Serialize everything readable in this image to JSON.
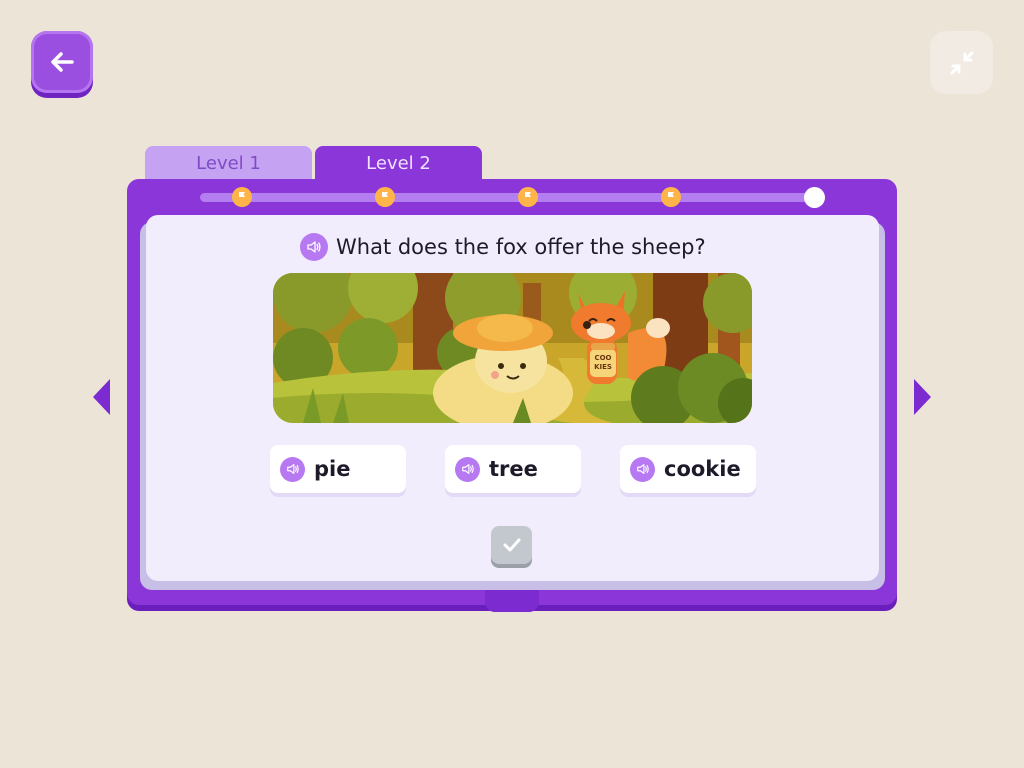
{
  "header": {
    "back_icon": "arrow-left-icon",
    "minimize_icon": "minimize-arrows-icon"
  },
  "tabs": [
    {
      "label": "Level 1",
      "active": false
    },
    {
      "label": "Level 2",
      "active": true
    }
  ],
  "progress": {
    "milestone_count": 4,
    "milestone_icon": "flag-icon",
    "current_position": "end"
  },
  "question": {
    "text": "What does the fox offer the sheep?",
    "icon": "speaker-icon"
  },
  "illustration": {
    "jar_label_line1": "COO",
    "jar_label_line2": "KIES"
  },
  "answers": [
    {
      "label": "pie",
      "icon": "speaker-icon"
    },
    {
      "label": "tree",
      "icon": "speaker-icon"
    },
    {
      "label": "cookie",
      "icon": "speaker-icon"
    }
  ],
  "check": {
    "icon": "checkmark-icon",
    "enabled": false
  },
  "navigation": {
    "prev_icon": "triangle-left-icon",
    "next_icon": "triangle-right-icon"
  },
  "colors": {
    "background": "#ede4d8",
    "accent_purple": "#8a36d8",
    "milestone_orange": "#ffb44a",
    "page": "#f1edfc"
  }
}
